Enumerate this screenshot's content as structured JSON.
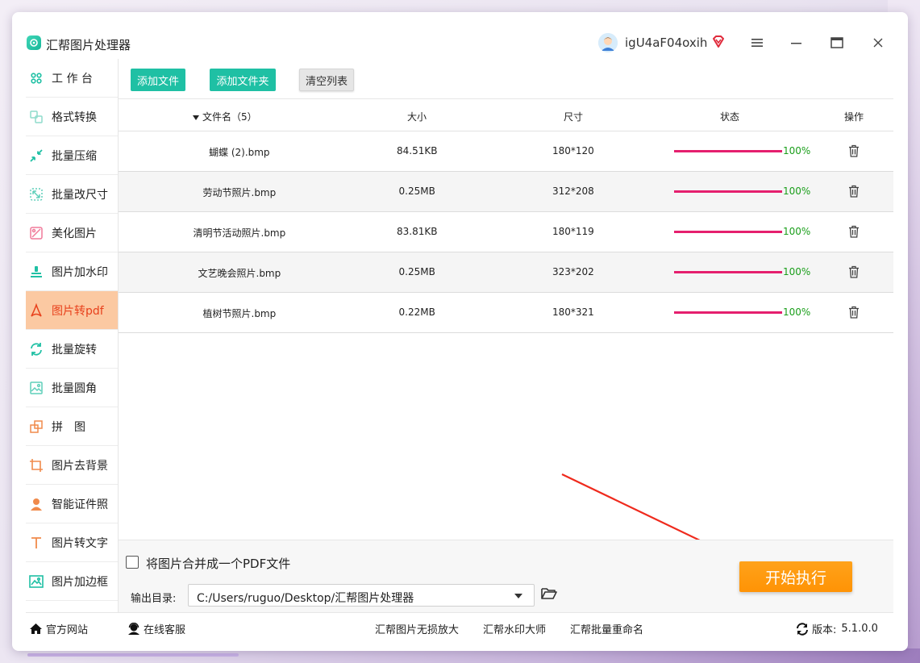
{
  "app": {
    "title": "汇帮图片处理器",
    "username": "igU4aF04oxih",
    "colors": {
      "accent": "#1fc0a4",
      "active_bg": "#fbc9a2",
      "active_text": "#e8411c",
      "progress": "#e51f6e",
      "start": "#ff9a0d"
    }
  },
  "sidebar": {
    "items": [
      {
        "label": "工 作 台",
        "icon": "grid-icon"
      },
      {
        "label": "格式转换",
        "icon": "format-convert-icon"
      },
      {
        "label": "批量压缩",
        "icon": "compress-icon"
      },
      {
        "label": "批量改尺寸",
        "icon": "resize-icon"
      },
      {
        "label": "美化图片",
        "icon": "beautify-icon"
      },
      {
        "label": "图片加水印",
        "icon": "watermark-icon"
      },
      {
        "label": "图片转pdf",
        "icon": "pdf-icon",
        "active": true
      },
      {
        "label": "批量旋转",
        "icon": "rotate-icon"
      },
      {
        "label": "批量圆角",
        "icon": "round-corner-icon"
      },
      {
        "label": "拼　图",
        "icon": "collage-icon"
      },
      {
        "label": "图片去背景",
        "icon": "crop-icon"
      },
      {
        "label": "智能证件照",
        "icon": "person-icon"
      },
      {
        "label": "图片转文字",
        "icon": "text-icon"
      },
      {
        "label": "图片加边框",
        "icon": "frame-icon"
      }
    ]
  },
  "toolbar": {
    "add_file": "添加文件",
    "add_folder": "添加文件夹",
    "clear_list": "清空列表"
  },
  "table": {
    "headers": {
      "name": "文件名（5）",
      "size": "大小",
      "dims": "尺寸",
      "status": "状态",
      "ops": "操作"
    },
    "rows": [
      {
        "name": "蝴蝶 (2).bmp",
        "size": "84.51KB",
        "dims": "180*120",
        "progress": 100,
        "pct": "100%"
      },
      {
        "name": "劳动节照片.bmp",
        "size": "0.25MB",
        "dims": "312*208",
        "progress": 100,
        "pct": "100%"
      },
      {
        "name": "清明节活动照片.bmp",
        "size": "83.81KB",
        "dims": "180*119",
        "progress": 100,
        "pct": "100%"
      },
      {
        "name": "文艺晚会照片.bmp",
        "size": "0.25MB",
        "dims": "323*202",
        "progress": 100,
        "pct": "100%"
      },
      {
        "name": "植树节照片.bmp",
        "size": "0.22MB",
        "dims": "180*321",
        "progress": 100,
        "pct": "100%"
      }
    ]
  },
  "bottom": {
    "merge_label": "将图片合并成一个PDF文件",
    "merge_checked": false,
    "output_label": "输出目录:",
    "output_path": "C:/Users/ruguo/Desktop/汇帮图片处理器",
    "start_label": "开始执行"
  },
  "statusbar": {
    "website": "官方网站",
    "support": "在线客服",
    "link1": "汇帮图片无损放大",
    "link2": "汇帮水印大师",
    "link3": "汇帮批量重命名",
    "version_label": "版本:",
    "version": "5.1.0.0"
  }
}
